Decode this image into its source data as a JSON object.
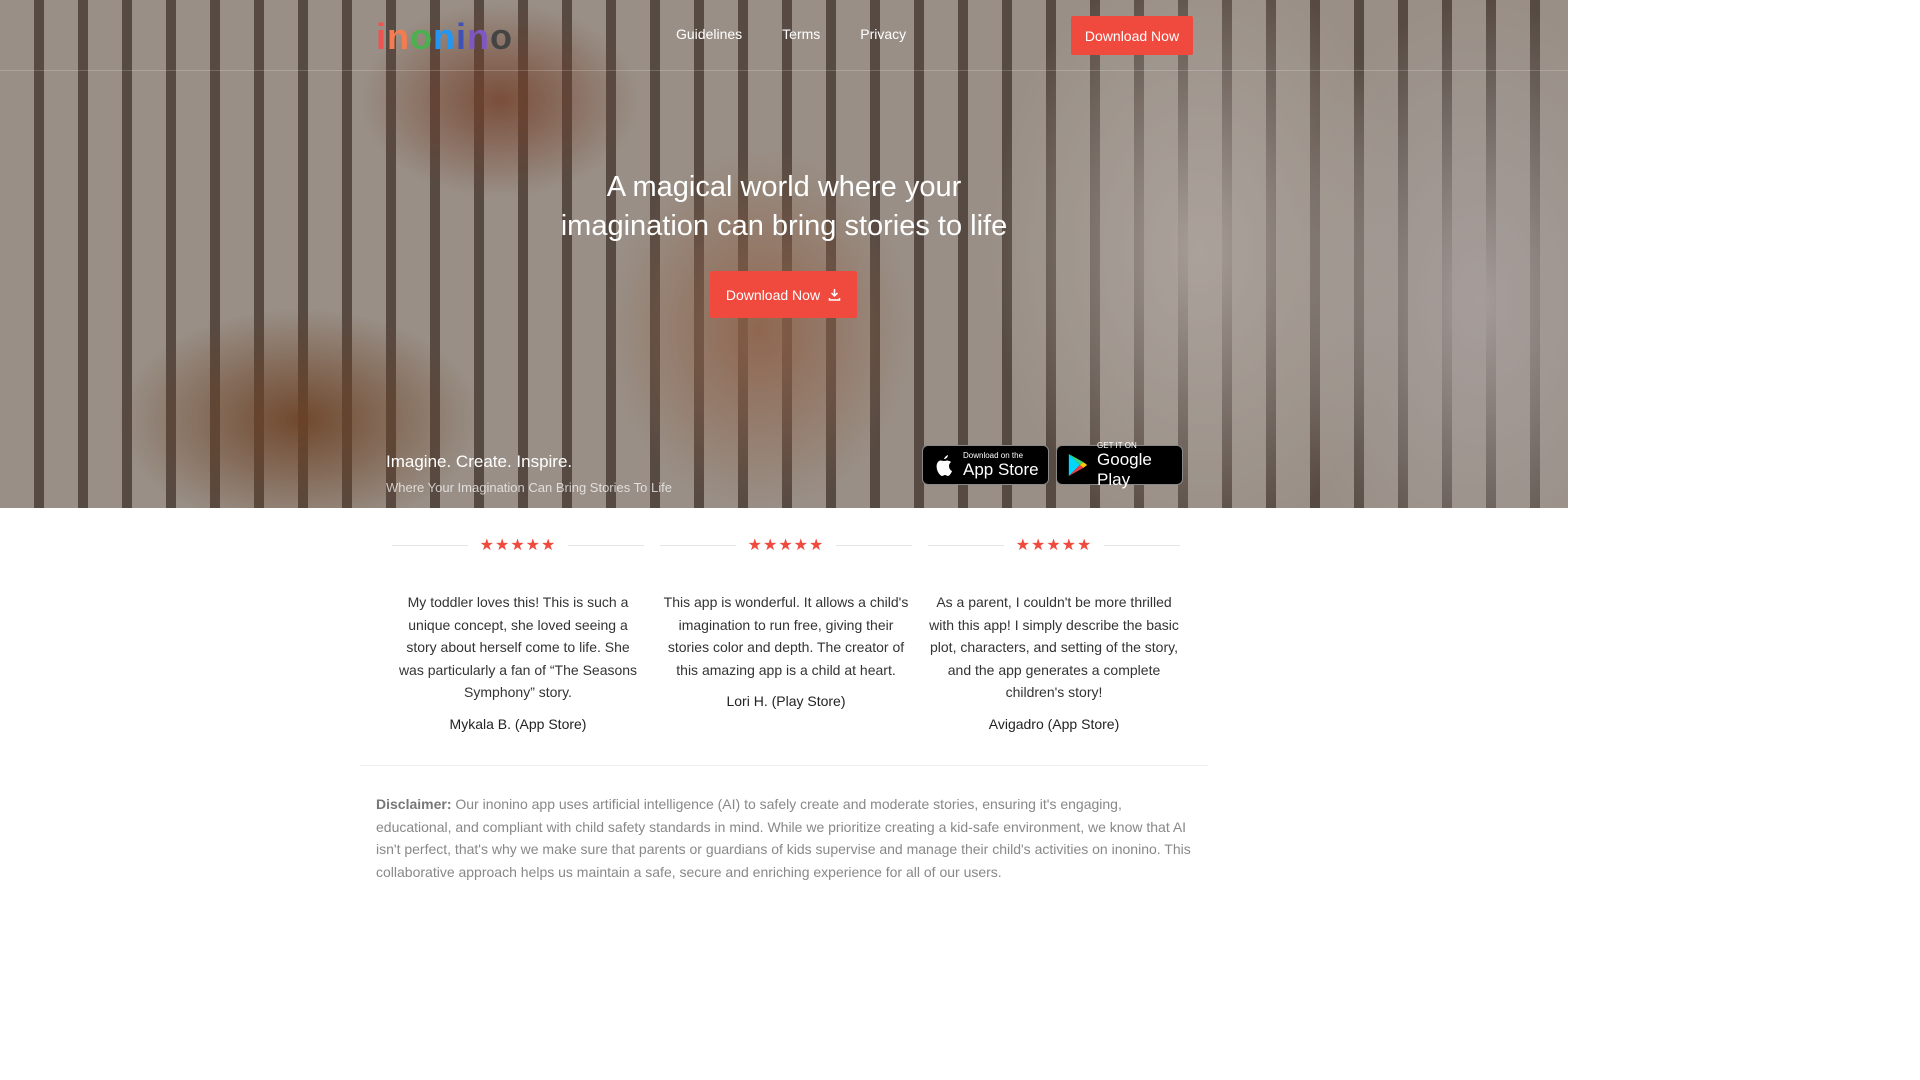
{
  "nav": {
    "logo": "inonino",
    "logo_letters": [
      "i",
      "n",
      "o",
      "n",
      "i",
      "n",
      "o"
    ],
    "links": [
      "Guidelines",
      "Terms",
      "Privacy"
    ],
    "download": "Download Now"
  },
  "hero": {
    "headline_1": "A magical world where your",
    "headline_2": "imagination can bring stories to life",
    "cta": "Download Now",
    "cta_icon": "download-icon",
    "tagline": "Imagine. Create. Inspire.",
    "subtagline": "Where Your Imagination Can Bring Stories To Life",
    "app_store": {
      "small": "Download on the",
      "big": "App Store"
    },
    "google_play": {
      "small": "GET IT ON",
      "big": "Google Play"
    }
  },
  "reviews": [
    {
      "stars": 5,
      "text": "My toddler loves this! This is such a unique concept, she loved seeing a story about herself come to life. She was particularly a fan of “The Seasons Symphony” story.",
      "author": "Mykala B. (App Store)"
    },
    {
      "stars": 5,
      "text": "This app is wonderful. It allows a child's imagination to run free, giving their stories color and depth. The creator of this amazing app is a child at heart.",
      "author": "Lori H. (Play Store)"
    },
    {
      "stars": 5,
      "text": "As a parent, I couldn't be more thrilled with this app! I simply describe the basic plot, characters, and setting of the story, and the app generates a complete children's story!",
      "author": "Avigadro (App Store)"
    }
  ],
  "disclaimer": {
    "label": "Disclaimer:",
    "text": " Our inonino app uses artificial intelligence (AI) to safely create and moderate stories, ensuring it's engaging, educational, and compliant with child safety standards in mind. While we prioritize creating a kid-safe environment, we know that AI isn't perfect, that's why we make sure that parents or guardians of kids supervise and manage their child's activities on inonino. This collaborative approach helps us maintain a safe, secure and enriching experience for all of our users."
  },
  "colors": {
    "accent": "#f04a3e"
  }
}
